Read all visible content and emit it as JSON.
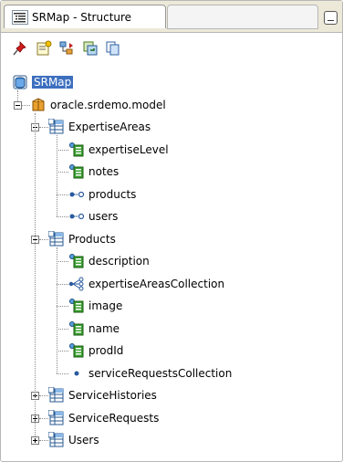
{
  "tab": {
    "title": "SRMap - Structure",
    "icon": "structure-icon"
  },
  "toolbar": {
    "icons": [
      "pin-icon",
      "new-note-icon",
      "hierarchy-icon",
      "refresh-icon",
      "copy-icon"
    ]
  },
  "tree": {
    "root": "SRMap",
    "package": "oracle.srdemo.model",
    "nodes": [
      {
        "label": "ExpertiseAreas",
        "children": [
          {
            "label": "expertiseLevel",
            "kind": "attribute"
          },
          {
            "label": "notes",
            "kind": "attribute"
          },
          {
            "label": "products",
            "kind": "reference"
          },
          {
            "label": "users",
            "kind": "reference"
          }
        ]
      },
      {
        "label": "Products",
        "children": [
          {
            "label": "description",
            "kind": "attribute"
          },
          {
            "label": "expertiseAreasCollection",
            "kind": "collection"
          },
          {
            "label": "image",
            "kind": "attribute"
          },
          {
            "label": "name",
            "kind": "attribute"
          },
          {
            "label": "prodId",
            "kind": "attribute"
          },
          {
            "label": "serviceRequestsCollection",
            "kind": "link"
          }
        ]
      },
      {
        "label": "ServiceHistories",
        "children": []
      },
      {
        "label": "ServiceRequests",
        "children": []
      },
      {
        "label": "Users",
        "children": []
      }
    ]
  },
  "colors": {
    "selection": "#3d6fbf",
    "tabbar": "#ece9d8"
  }
}
